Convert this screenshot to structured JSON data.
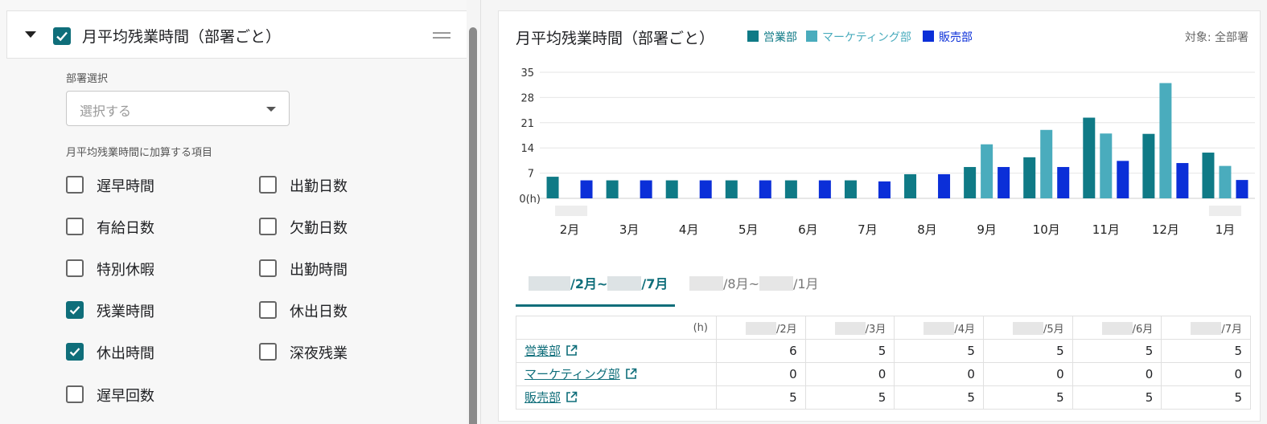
{
  "panel": {
    "title": "月平均残業時間（部署ごと）",
    "dept_label": "部署選択",
    "dept_placeholder": "選択する",
    "items_label": "月平均残業時間に加算する項目",
    "options": [
      {
        "label": "遅早時間",
        "checked": false
      },
      {
        "label": "出勤日数",
        "checked": false
      },
      {
        "label": "有給日数",
        "checked": false
      },
      {
        "label": "欠勤日数",
        "checked": false
      },
      {
        "label": "特別休暇",
        "checked": false
      },
      {
        "label": "出勤時間",
        "checked": false
      },
      {
        "label": "残業時間",
        "checked": true
      },
      {
        "label": "休出日数",
        "checked": false
      },
      {
        "label": "休出時間",
        "checked": true
      },
      {
        "label": "深夜残業",
        "checked": false
      },
      {
        "label": "遅早回数",
        "checked": false
      }
    ]
  },
  "card": {
    "title": "月平均残業時間（部署ごと）",
    "target": "対象: 全部署"
  },
  "chart_data": {
    "type": "bar",
    "categories": [
      "2月",
      "3月",
      "4月",
      "5月",
      "6月",
      "7月",
      "8月",
      "9月",
      "10月",
      "11月",
      "12月",
      "1月"
    ],
    "ylabel_unit": "0(h)",
    "y_ticks": [
      "35",
      "28",
      "21",
      "14",
      "7"
    ],
    "ylim": [
      0,
      35
    ],
    "grid": true,
    "legend_position": "top",
    "series": [
      {
        "name": "営業部",
        "color": "#0f7a86",
        "values": [
          6,
          5,
          5,
          5,
          5,
          5,
          6.7,
          8.7,
          11.4,
          22.4,
          17.9,
          12.7
        ]
      },
      {
        "name": "マーケティング部",
        "color": "#4aacbd",
        "values": [
          0,
          0,
          0,
          0,
          0,
          0,
          0,
          15,
          19,
          18,
          32,
          9
        ]
      },
      {
        "name": "販売部",
        "color": "#0b2fd8",
        "values": [
          5,
          5,
          5,
          5,
          5,
          4.7,
          6.7,
          8.7,
          8.7,
          10.4,
          9.8,
          5.1
        ]
      }
    ]
  },
  "tabs": [
    {
      "label_a": "/2月~",
      "label_b": "/7月",
      "active": true
    },
    {
      "label_a": "/8月~",
      "label_b": "/1月",
      "active": false
    }
  ],
  "table": {
    "unit": "(h)",
    "months": [
      "/2月",
      "/3月",
      "/4月",
      "/5月",
      "/6月",
      "/7月"
    ],
    "rows": [
      {
        "name": "営業部",
        "values": [
          "6",
          "5",
          "5",
          "5",
          "5",
          "5"
        ]
      },
      {
        "name": "マーケティング部",
        "values": [
          "0",
          "0",
          "0",
          "0",
          "0",
          "0"
        ]
      },
      {
        "name": "販売部",
        "values": [
          "5",
          "5",
          "5",
          "5",
          "5",
          "5"
        ]
      }
    ]
  }
}
